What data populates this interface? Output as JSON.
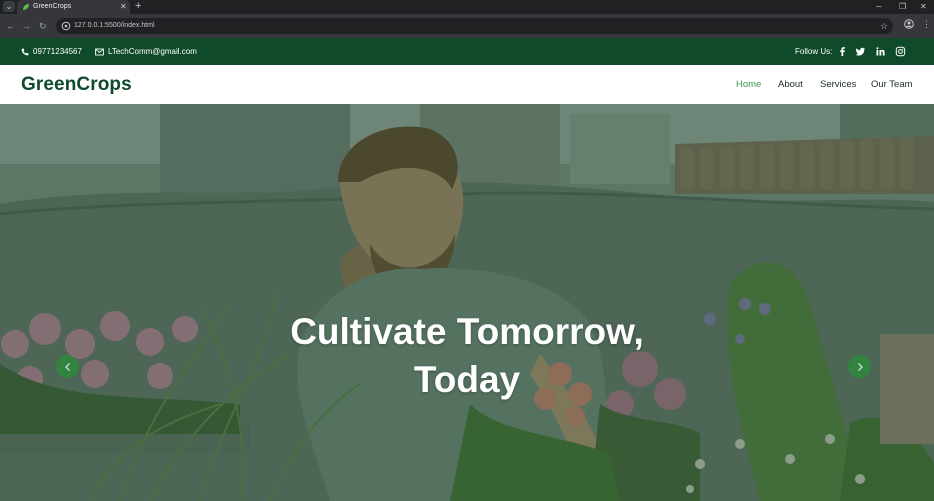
{
  "browser": {
    "tab_title": "GreenCrops",
    "url": "127.0.0.1:5500/index.html"
  },
  "topbar": {
    "phone": "09771234567",
    "email": "LTechComm@gmail.com",
    "follow_label": "Follow Us:",
    "socials": [
      "facebook-icon",
      "twitter-icon",
      "linkedin-icon",
      "instagram-icon"
    ]
  },
  "navbar": {
    "brand": "GreenCrops",
    "links": [
      {
        "label": "Home",
        "active": true
      },
      {
        "label": "About",
        "active": false
      },
      {
        "label": "Services",
        "active": false
      },
      {
        "label": "Our Team",
        "active": false
      }
    ]
  },
  "hero": {
    "title_line1": "Cultivate Tomorrow,",
    "title_line2": "Today"
  },
  "colors": {
    "brand_green": "#0f4a2a",
    "accent_green": "#3d9a4d",
    "slider_green": "#2e8a3d"
  }
}
